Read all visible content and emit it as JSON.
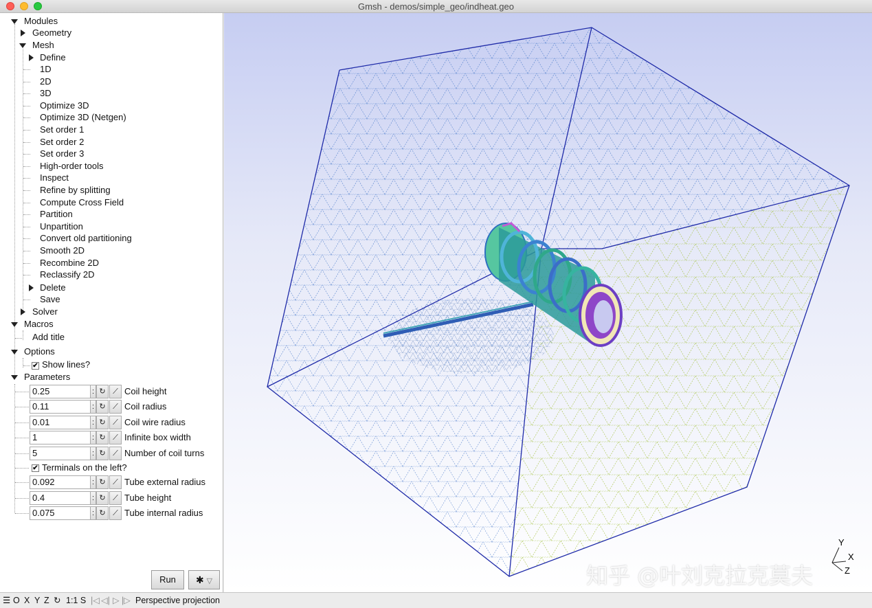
{
  "window": {
    "title": "Gmsh - demos/simple_geo/indheat.geo"
  },
  "tree": {
    "modules": "Modules",
    "geometry": "Geometry",
    "mesh": "Mesh",
    "mesh_items": [
      "Define",
      "1D",
      "2D",
      "3D",
      "Optimize 3D",
      "Optimize 3D (Netgen)",
      "Set order 1",
      "Set order 2",
      "Set order 3",
      "High-order tools",
      "Inspect",
      "Refine by splitting",
      "Compute Cross Field",
      "Partition",
      "Unpartition",
      "Convert old partitioning",
      "Smooth 2D",
      "Recombine 2D",
      "Reclassify 2D",
      "Delete",
      "Save"
    ],
    "solver": "Solver",
    "macros": "Macros",
    "add_title": "Add title",
    "options": "Options",
    "show_lines": "Show lines?",
    "parameters": "Parameters"
  },
  "parameters": [
    {
      "value": "0.25",
      "label": "Coil height"
    },
    {
      "value": "0.11",
      "label": "Coil radius"
    },
    {
      "value": "0.01",
      "label": "Coil wire radius"
    },
    {
      "value": "1",
      "label": "Infinite box width"
    },
    {
      "value": "5",
      "label": "Number of coil turns"
    },
    {
      "checkbox": true,
      "label": "Terminals on the left?"
    },
    {
      "value": "0.092",
      "label": "Tube external radius"
    },
    {
      "value": "0.4",
      "label": "Tube height"
    },
    {
      "value": "0.075",
      "label": "Tube internal radius"
    }
  ],
  "buttons": {
    "run": "Run",
    "settings_glyph": "✱"
  },
  "axes": {
    "y": "Y",
    "x": "X",
    "z": "Z"
  },
  "watermark": "知乎 @叶刘克拉克莫夫",
  "statusbar": {
    "menu": "☰",
    "views": [
      "O",
      "X",
      "Y",
      "Z"
    ],
    "rotate": "↻",
    "scale": "1:1 S",
    "nav": [
      "|◁",
      "◁|",
      "▷",
      "|▷"
    ],
    "message": "Perspective projection"
  },
  "colors": {
    "cube_edge": "#1e2aa8",
    "mesh_blue": "#4a78c8",
    "mesh_green": "#9ec23c",
    "accent_bg": "#c6cdf2"
  }
}
